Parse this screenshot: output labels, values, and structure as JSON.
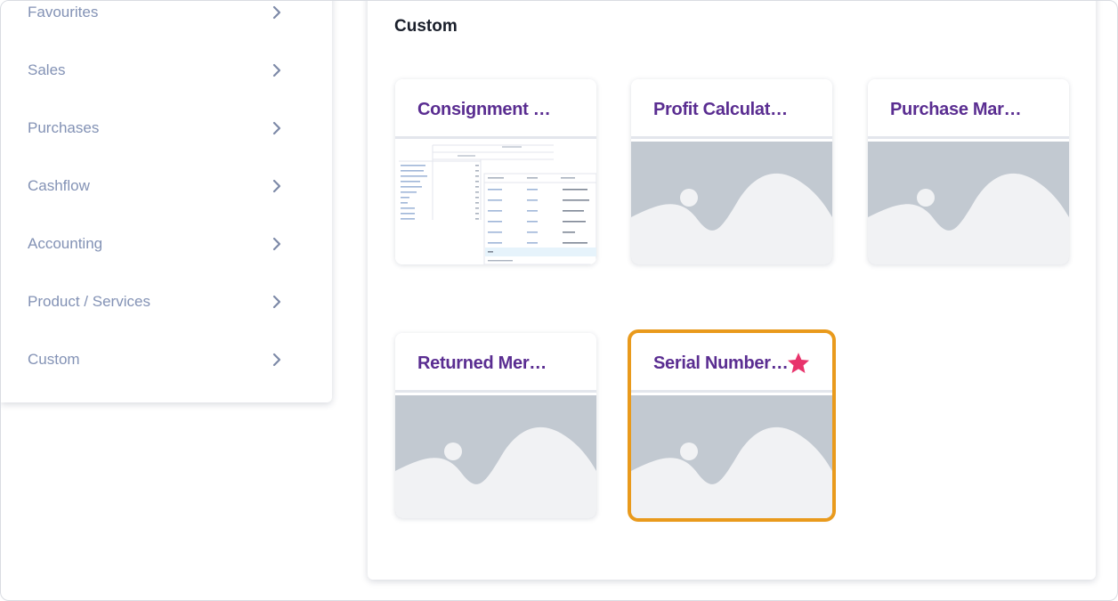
{
  "sidebar": {
    "items": [
      {
        "label": "Favourites"
      },
      {
        "label": "Sales"
      },
      {
        "label": "Purchases"
      },
      {
        "label": "Cashflow"
      },
      {
        "label": "Accounting"
      },
      {
        "label": "Product / Services"
      },
      {
        "label": "Custom"
      }
    ],
    "chevron_icon": "chevron-right-icon"
  },
  "main": {
    "section_title": "Custom",
    "cards": [
      {
        "title": "Consignment …",
        "thumbnail": "table-report-preview",
        "favourite": false
      },
      {
        "title": "Profit Calculat…",
        "thumbnail": "image-placeholder-icon",
        "favourite": false
      },
      {
        "title": "Purchase Mar…",
        "thumbnail": "image-placeholder-icon",
        "favourite": false
      },
      {
        "title": "Returned Mer…",
        "thumbnail": "image-placeholder-icon",
        "favourite": false
      },
      {
        "title": "Serial Number…",
        "thumbnail": "image-placeholder-icon",
        "favourite": true,
        "selected": true
      }
    ]
  },
  "colors": {
    "card_title": "#5a2d91",
    "sidebar_text": "#8392b5",
    "selected_border": "#e99a1c",
    "star": "#e8336b",
    "placeholder_bg": "#c2c9d1",
    "placeholder_fg": "#f1f2f4"
  }
}
